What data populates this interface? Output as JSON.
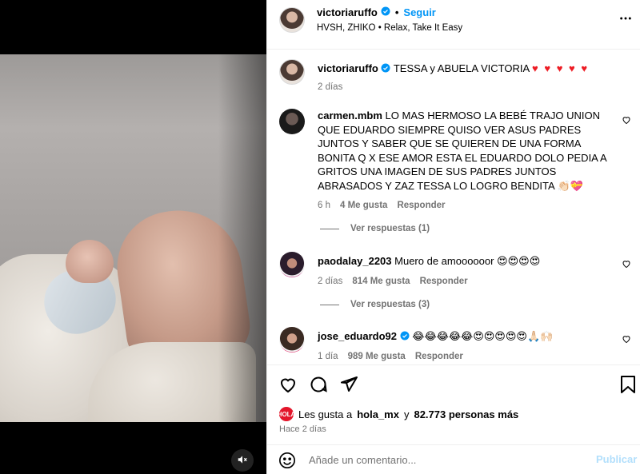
{
  "post": {
    "username": "victoriaruffo",
    "follow_label": "Seguir",
    "music": "HVSH, ZHIKO",
    "music_track": "Relax, Take It Easy"
  },
  "caption": {
    "username": "victoriaruffo",
    "text": "TESSA y ABUELA VICTORIA",
    "hearts": "♥ ♥ ♥ ♥ ♥",
    "time": "2 días"
  },
  "comments": [
    {
      "username": "carmen.mbm",
      "text": "LO MAS HERMOSO LA BEBÉ TRAJO UNION QUE EDUARDO SIEMPRE QUISO VER ASUS PADRES JUNTOS Y SABER QUE SE QUIEREN DE UNA FORMA BONITA Q X ESE AMOR ESTA EL EDUARDO DOLO PEDIA A GRITOS UNA IMAGEN DE SUS PADRES JUNTOS ABRASADOS Y ZAZ TESSA LO LOGRO BENDITA 👏🏻💝",
      "time": "6 h",
      "likes": "4 Me gusta",
      "reply": "Responder",
      "view_replies": "Ver respuestas (1)"
    },
    {
      "username": "paodalay_2203",
      "text": "Muero de amoooooor 😍😍😍😍",
      "time": "2 días",
      "likes": "814 Me gusta",
      "reply": "Responder",
      "view_replies": "Ver respuestas (3)"
    },
    {
      "username": "jose_eduardo92",
      "text": "😂😂😂😂😂😍😍😍😍😍🙏🏻🙌🏻",
      "time": "1 día",
      "likes": "989 Me gusta",
      "reply": "Responder"
    }
  ],
  "likes": {
    "prefix": "Les gusta a",
    "user": "hola_mx",
    "middle": "y",
    "count": "82.773 personas más",
    "avatar_text": "¡HOLA!"
  },
  "posted_ago": "Hace 2 días",
  "composer": {
    "placeholder": "Añade un comentario...",
    "publish_label": "Publicar"
  },
  "colors": {
    "accent": "#0095f6",
    "heart": "#ed1c24",
    "muted_text": "#737373",
    "publish_disabled": "#b2dffc"
  },
  "icons": [
    "verified-badge-icon",
    "more-options-icon",
    "heart-icon",
    "comment-icon",
    "share-icon",
    "save-icon",
    "emoji-icon",
    "sound-off-icon"
  ]
}
